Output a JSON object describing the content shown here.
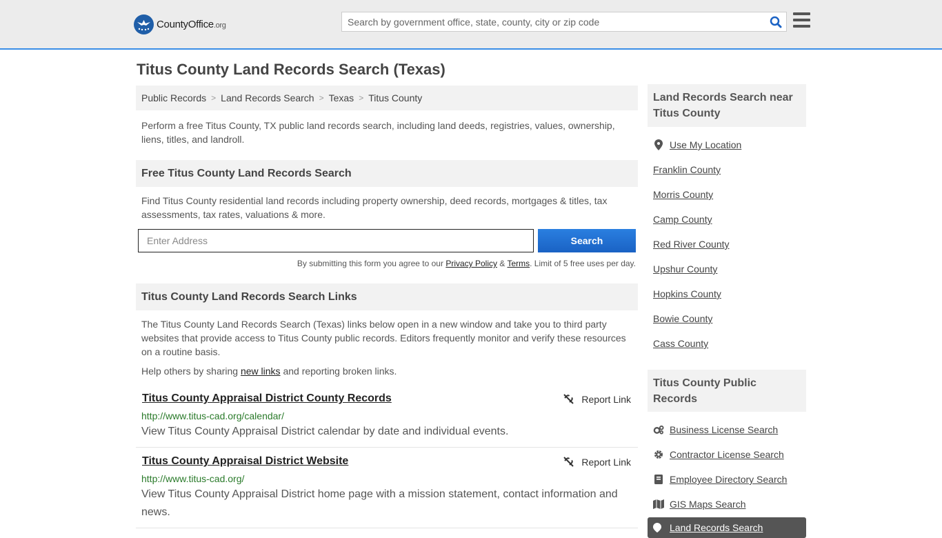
{
  "header": {
    "logo_main": "CountyOffice",
    "logo_org": ".org",
    "search_placeholder": "Search by government office, state, county, city or zip code"
  },
  "page": {
    "title": "Titus County Land Records Search (Texas)",
    "breadcrumb": [
      "Public Records",
      "Land Records Search",
      "Texas",
      "Titus County"
    ],
    "intro": "Perform a free Titus County, TX public land records search, including land deeds, registries, values, ownership, liens, titles, and landroll."
  },
  "free_search": {
    "heading": "Free Titus County Land Records Search",
    "description": "Find Titus County residential land records including property ownership, deed records, mortgages & titles, tax assessments, tax rates, valuations & more.",
    "address_placeholder": "Enter Address",
    "button_label": "Search",
    "disclaimer_prefix": "By submitting this form you agree to our ",
    "privacy_label": "Privacy Policy",
    "amp": " & ",
    "terms_label": "Terms",
    "disclaimer_suffix": ". Limit of 5 free uses per day."
  },
  "links_section": {
    "heading": "Titus County Land Records Search Links",
    "description": "The Titus County Land Records Search (Texas) links below open in a new window and take you to third party websites that provide access to Titus County public records. Editors frequently monitor and verify these resources on a routine basis.",
    "help_prefix": "Help others by sharing ",
    "help_link": "new links",
    "help_suffix": " and reporting broken links.",
    "report_label": "Report Link",
    "items": [
      {
        "title": "Titus County Appraisal District County Records",
        "url": "http://www.titus-cad.org/calendar/",
        "description": "View Titus County Appraisal District calendar by date and individual events."
      },
      {
        "title": "Titus County Appraisal District Website",
        "url": "http://www.titus-cad.org/",
        "description": "View Titus County Appraisal District home page with a mission statement, contact information and news."
      }
    ]
  },
  "sidebar": {
    "nearby_heading": "Land Records Search near Titus County",
    "use_location": "Use My Location",
    "nearby": [
      "Franklin County",
      "Morris County",
      "Camp County",
      "Red River County",
      "Upshur County",
      "Hopkins County",
      "Bowie County",
      "Cass County"
    ],
    "records_heading": "Titus County Public Records",
    "records": [
      {
        "label": "Business License Search",
        "icon": "gears-icon"
      },
      {
        "label": "Contractor License Search",
        "icon": "gear-icon"
      },
      {
        "label": "Employee Directory Search",
        "icon": "book-icon"
      },
      {
        "label": "GIS Maps Search",
        "icon": "map-icon"
      }
    ],
    "active_item": "Land Records Search"
  }
}
